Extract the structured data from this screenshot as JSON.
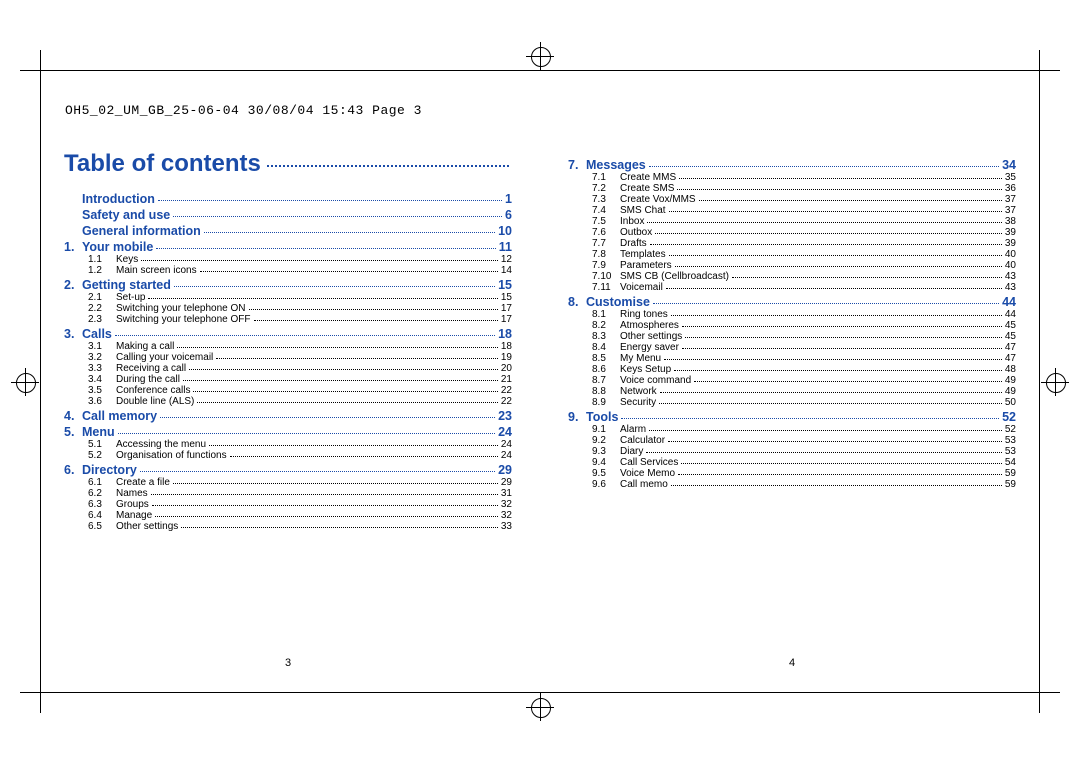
{
  "header": "OH5_02_UM_GB_25-06-04  30/08/04  15:43  Page 3",
  "title": "Table of contents",
  "left": {
    "page_number": "3",
    "pre": [
      {
        "label": "Introduction",
        "page": "1"
      },
      {
        "label": "Safety and use",
        "page": "6"
      },
      {
        "label": "General information",
        "page": "10"
      }
    ],
    "sections": [
      {
        "num": "1.",
        "label": "Your mobile",
        "page": "11",
        "subs": [
          {
            "num": "1.1",
            "label": "Keys",
            "page": "12"
          },
          {
            "num": "1.2",
            "label": "Main screen icons",
            "page": "14"
          }
        ]
      },
      {
        "num": "2.",
        "label": "Getting started",
        "page": "15",
        "subs": [
          {
            "num": "2.1",
            "label": "Set-up",
            "page": "15"
          },
          {
            "num": "2.2",
            "label": "Switching your telephone ON",
            "page": "17"
          },
          {
            "num": "2.3",
            "label": "Switching your telephone OFF",
            "page": "17"
          }
        ]
      },
      {
        "num": "3.",
        "label": "Calls",
        "page": "18",
        "subs": [
          {
            "num": "3.1",
            "label": "Making a call",
            "page": "18"
          },
          {
            "num": "3.2",
            "label": "Calling your voicemail",
            "page": "19"
          },
          {
            "num": "3.3",
            "label": "Receiving a call",
            "page": "20"
          },
          {
            "num": "3.4",
            "label": "During the call",
            "page": "21"
          },
          {
            "num": "3.5",
            "label": "Conference calls",
            "page": "22"
          },
          {
            "num": "3.6",
            "label": "Double line (ALS)",
            "page": "22"
          }
        ]
      },
      {
        "num": "4.",
        "label": "Call memory",
        "page": "23",
        "subs": []
      },
      {
        "num": "5.",
        "label": "Menu",
        "page": "24",
        "subs": [
          {
            "num": "5.1",
            "label": "Accessing the menu",
            "page": "24"
          },
          {
            "num": "5.2",
            "label": "Organisation of functions",
            "page": "24"
          }
        ]
      },
      {
        "num": "6.",
        "label": "Directory",
        "page": "29",
        "subs": [
          {
            "num": "6.1",
            "label": "Create a file",
            "page": "29"
          },
          {
            "num": "6.2",
            "label": "Names",
            "page": "31"
          },
          {
            "num": "6.3",
            "label": "Groups",
            "page": "32"
          },
          {
            "num": "6.4",
            "label": "Manage",
            "page": "32"
          },
          {
            "num": "6.5",
            "label": "Other settings",
            "page": "33"
          }
        ]
      }
    ]
  },
  "right": {
    "page_number": "4",
    "sections": [
      {
        "num": "7.",
        "label": "Messages",
        "page": "34",
        "subs": [
          {
            "num": "7.1",
            "label": "Create MMS",
            "page": "35"
          },
          {
            "num": "7.2",
            "label": "Create SMS",
            "page": "36"
          },
          {
            "num": "7.3",
            "label": "Create Vox/MMS",
            "page": "37"
          },
          {
            "num": "7.4",
            "label": "SMS Chat",
            "page": "37"
          },
          {
            "num": "7.5",
            "label": "Inbox",
            "page": "38"
          },
          {
            "num": "7.6",
            "label": "Outbox",
            "page": "39"
          },
          {
            "num": "7.7",
            "label": "Drafts",
            "page": "39"
          },
          {
            "num": "7.8",
            "label": "Templates",
            "page": "40"
          },
          {
            "num": "7.9",
            "label": "Parameters",
            "page": "40"
          },
          {
            "num": "7.10",
            "label": "SMS CB (Cellbroadcast)",
            "page": "43"
          },
          {
            "num": "7.11",
            "label": "Voicemail",
            "page": "43"
          }
        ]
      },
      {
        "num": "8.",
        "label": "Customise",
        "page": "44",
        "subs": [
          {
            "num": "8.1",
            "label": "Ring tones",
            "page": "44"
          },
          {
            "num": "8.2",
            "label": "Atmospheres",
            "page": "45"
          },
          {
            "num": "8.3",
            "label": "Other settings",
            "page": "45"
          },
          {
            "num": "8.4",
            "label": "Energy saver",
            "page": "47"
          },
          {
            "num": "8.5",
            "label": "My Menu",
            "page": "47"
          },
          {
            "num": "8.6",
            "label": "Keys Setup",
            "page": "48"
          },
          {
            "num": "8.7",
            "label": "Voice command",
            "page": "49"
          },
          {
            "num": "8.8",
            "label": "Network",
            "page": "49"
          },
          {
            "num": "8.9",
            "label": "Security",
            "page": "50"
          }
        ]
      },
      {
        "num": "9.",
        "label": "Tools",
        "page": "52",
        "subs": [
          {
            "num": "9.1",
            "label": "Alarm",
            "page": "52"
          },
          {
            "num": "9.2",
            "label": "Calculator",
            "page": "53"
          },
          {
            "num": "9.3",
            "label": "Diary",
            "page": "53"
          },
          {
            "num": "9.4",
            "label": "Call Services",
            "page": "54"
          },
          {
            "num": "9.5",
            "label": "Voice Memo",
            "page": "59"
          },
          {
            "num": "9.6",
            "label": "Call memo",
            "page": "59"
          }
        ]
      }
    ]
  }
}
